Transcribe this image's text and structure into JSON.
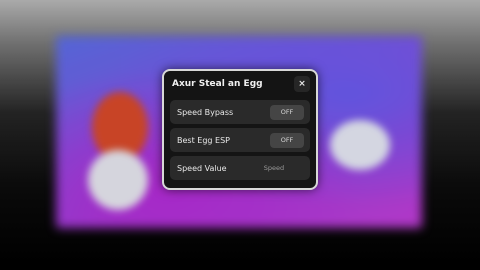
{
  "window": {
    "title": "Axur Steal an Egg",
    "close_label": "×"
  },
  "rows": [
    {
      "label": "Speed Bypass",
      "toggle": "OFF"
    },
    {
      "label": "Best Egg ESP",
      "toggle": "OFF"
    }
  ],
  "speed": {
    "label": "Speed Value",
    "placeholder": "Speed",
    "value": ""
  }
}
